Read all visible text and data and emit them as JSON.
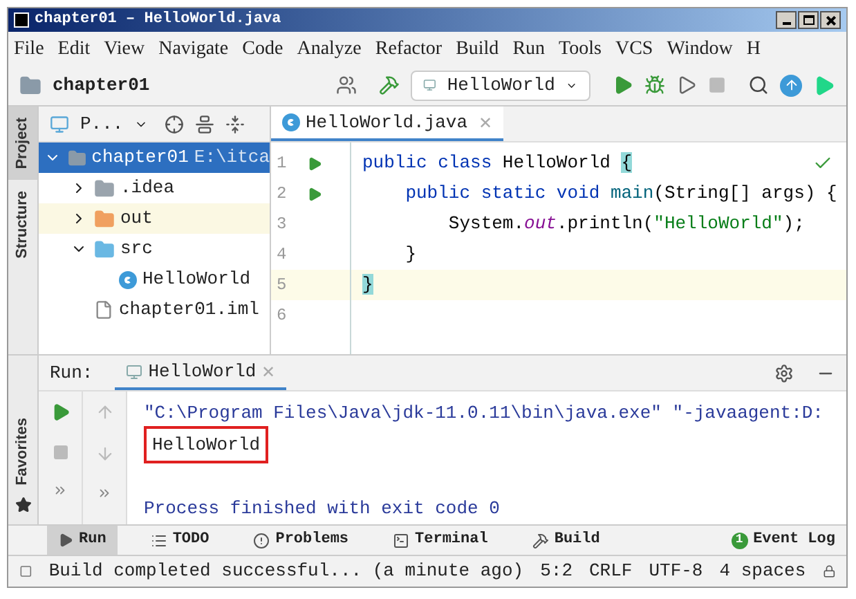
{
  "window": {
    "title": "chapter01 – HelloWorld.java"
  },
  "menu": [
    "File",
    "Edit",
    "View",
    "Navigate",
    "Code",
    "Analyze",
    "Refactor",
    "Build",
    "Run",
    "Tools",
    "VCS",
    "Window",
    "H"
  ],
  "toolbar": {
    "project": "chapter01",
    "run_config": "HelloWorld"
  },
  "side_tabs_top": [
    {
      "label": "Project",
      "selected": true
    },
    {
      "label": "Structure",
      "selected": false
    }
  ],
  "side_tabs_bottom": [
    {
      "label": "Favorites",
      "selected": false
    }
  ],
  "project_panel": {
    "title": "P...",
    "tree": [
      {
        "label": "chapter01",
        "path": "E:\\itca",
        "kind": "module",
        "selected": true,
        "expanded": true,
        "children": [
          {
            "label": ".idea",
            "kind": "folder",
            "expanded": false,
            "excluded": false,
            "selected": false
          },
          {
            "label": "out",
            "kind": "folder",
            "expanded": false,
            "excluded": true,
            "selected": false
          },
          {
            "label": "src",
            "kind": "source",
            "expanded": true,
            "excluded": false,
            "selected": false,
            "children": [
              {
                "label": "HelloWorld",
                "kind": "class",
                "selected": false
              }
            ]
          },
          {
            "label": "chapter01.iml",
            "kind": "file",
            "selected": false
          }
        ]
      }
    ]
  },
  "editor": {
    "tab": "HelloWorld.java",
    "close": "✕",
    "lines": [
      {
        "number": "1",
        "run": true,
        "current": false,
        "tokens": [
          {
            "kind": "keyword",
            "text": "public class "
          },
          {
            "kind": "plain",
            "text": "HelloWorld "
          },
          {
            "kind": "brace",
            "text": "{"
          }
        ]
      },
      {
        "number": "2",
        "run": true,
        "current": false,
        "tokens": [
          {
            "kind": "keyword",
            "text": "    public static void "
          },
          {
            "kind": "method",
            "text": "main"
          },
          {
            "kind": "plain",
            "text": "(String[] args) {"
          }
        ]
      },
      {
        "number": "3",
        "run": false,
        "current": false,
        "tokens": [
          {
            "kind": "plain",
            "text": "        System."
          },
          {
            "kind": "field",
            "text": "out"
          },
          {
            "kind": "plain",
            "text": ".println("
          },
          {
            "kind": "string",
            "text": "\"HelloWorld\""
          },
          {
            "kind": "plain",
            "text": ");"
          }
        ]
      },
      {
        "number": "4",
        "run": false,
        "current": false,
        "tokens": [
          {
            "kind": "plain",
            "text": "    }"
          }
        ]
      },
      {
        "number": "5",
        "run": false,
        "current": true,
        "tokens": [
          {
            "kind": "brace",
            "text": "}"
          }
        ]
      },
      {
        "number": "6",
        "run": false,
        "current": false
      }
    ]
  },
  "run_panel": {
    "label": "Run:",
    "tab": "HelloWorld",
    "close": "✕",
    "output": [
      {
        "kind": "command",
        "text": "\"C:\\Program Files\\Java\\jdk-11.0.11\\bin\\java.exe\" \"-javaagent:D:"
      },
      {
        "kind": "output",
        "text": "HelloWorld",
        "highlighted": true
      },
      {
        "kind": "exit",
        "text": "Process finished with exit code 0"
      }
    ]
  },
  "tool_windows": [
    {
      "label": "Run",
      "selected": true
    },
    {
      "label": "TODO",
      "selected": false
    },
    {
      "label": "Problems",
      "selected": false
    },
    {
      "label": "Terminal",
      "selected": false
    },
    {
      "label": "Build",
      "selected": false
    }
  ],
  "event_log": {
    "label": "Event Log",
    "count": "1"
  },
  "status_bar": {
    "message": "Build completed successful... (a minute ago)",
    "position": "5:2",
    "line_ending": "CRLF",
    "encoding": "UTF-8",
    "indent": "4 spaces"
  }
}
